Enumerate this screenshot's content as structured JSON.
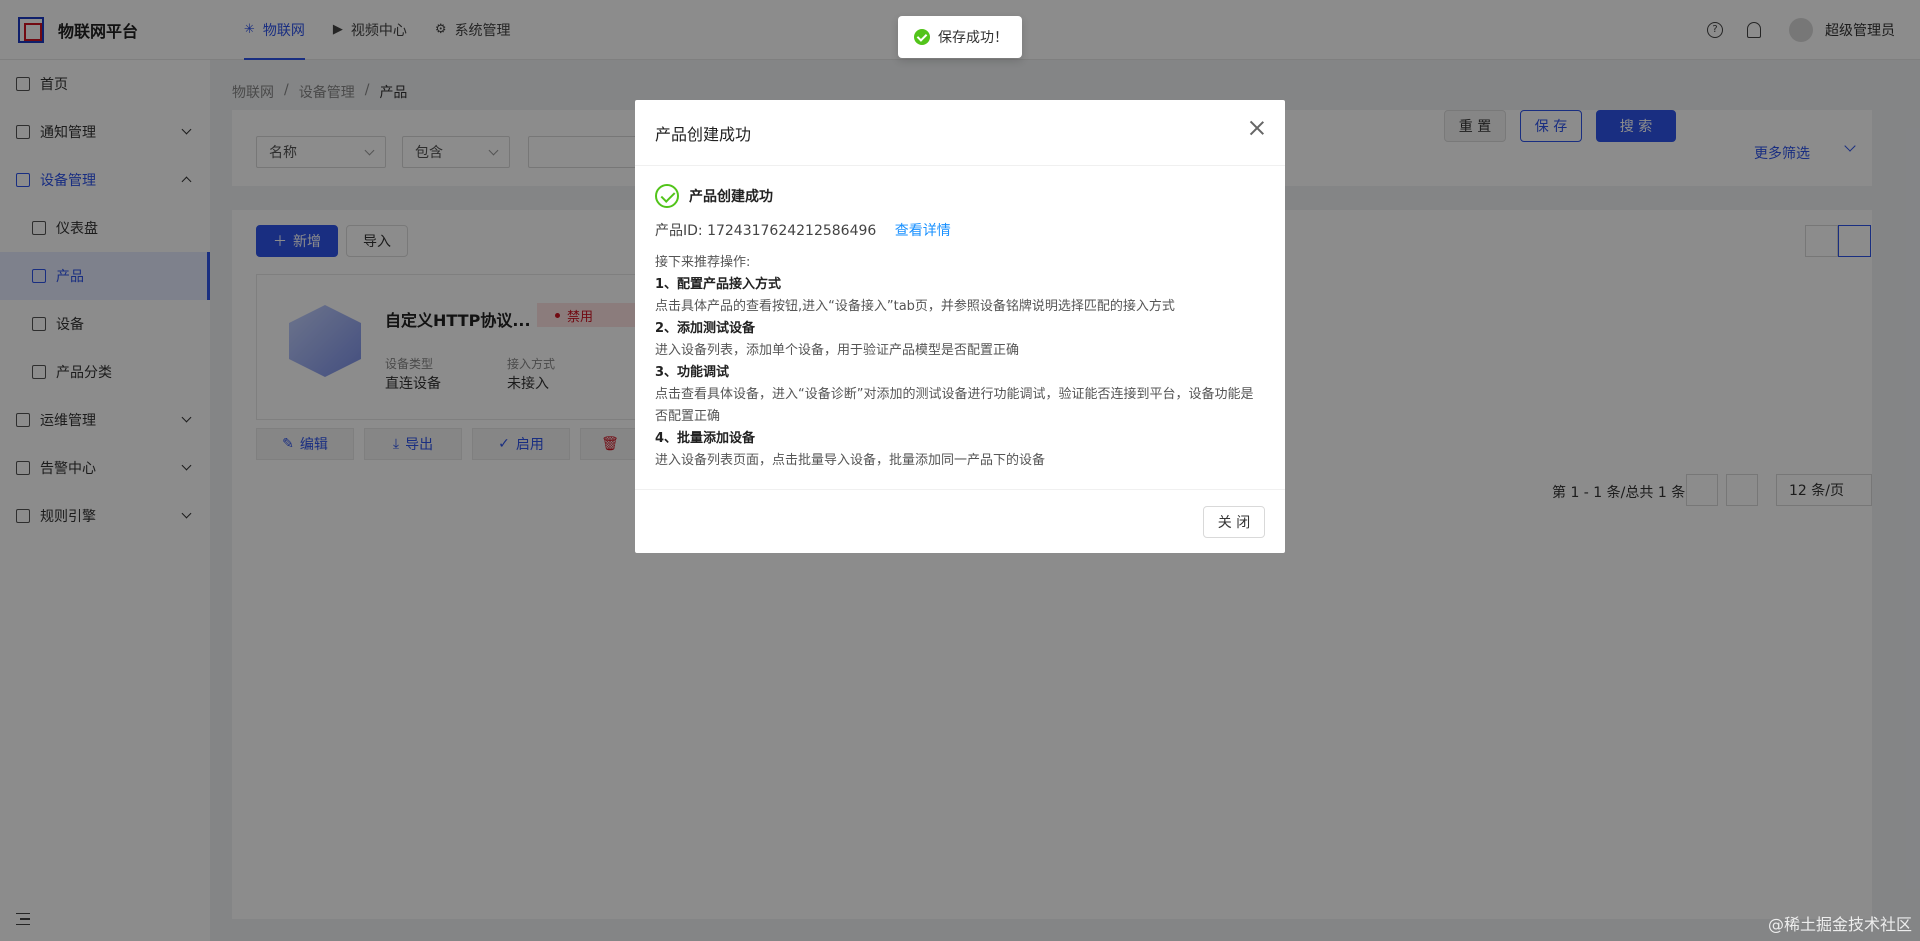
{
  "header": {
    "app_title": "物联网平台",
    "nav": [
      {
        "label": "物联网",
        "icon": "iot-icon"
      },
      {
        "label": "视频中心",
        "icon": "video-icon"
      },
      {
        "label": "系统管理",
        "icon": "settings-icon"
      }
    ],
    "username": "超级管理员"
  },
  "sidebar": {
    "items": [
      {
        "label": "首页"
      },
      {
        "label": "通知管理"
      },
      {
        "label": "设备管理"
      },
      {
        "label": "仪表盘"
      },
      {
        "label": "产品"
      },
      {
        "label": "设备"
      },
      {
        "label": "产品分类"
      },
      {
        "label": "运维管理"
      },
      {
        "label": "告警中心"
      },
      {
        "label": "规则引擎"
      }
    ]
  },
  "breadcrumb": [
    "物联网",
    "/",
    "设备管理",
    "/",
    "产品"
  ],
  "filter": {
    "field": "名称",
    "operator": "包含",
    "reset": "重 置",
    "save": "保 存",
    "search": "搜 索",
    "more": "更多筛选"
  },
  "list": {
    "add": "新增",
    "import": "导入",
    "card": {
      "name": "自定义HTTP协议...",
      "status": "禁用",
      "device_type_label": "设备类型",
      "device_type": "直连设备",
      "access_label": "接入方式",
      "access": "未接入"
    },
    "actions": {
      "edit": "编辑",
      "export": "导出",
      "enable": "启用"
    },
    "pagination": {
      "summary": "第 1 - 1 条/总共 1 条",
      "page_size": "12 条/页"
    }
  },
  "toast": {
    "text": "保存成功！"
  },
  "modal": {
    "title": "产品创建成功",
    "success_title": "产品创建成功",
    "id_text": "产品ID: 1724317624212586496",
    "detail_link": "查看详情",
    "intro": "接下来推荐操作:",
    "steps": [
      {
        "title": "1、配置产品接入方式",
        "desc": "点击具体产品的查看按钮,进入“设备接入”tab页，并参照设备铭牌说明选择匹配的接入方式"
      },
      {
        "title": "2、添加测试设备",
        "desc": "进入设备列表，添加单个设备，用于验证产品模型是否配置正确"
      },
      {
        "title": "3、功能调试",
        "desc": "点击查看具体设备，进入“设备诊断”对添加的测试设备进行功能调试，验证能否连接到平台，设备功能是否配置正确"
      },
      {
        "title": "4、批量添加设备",
        "desc": "进入设备列表页面，点击批量导入设备，批量添加同一产品下的设备"
      }
    ],
    "close": "关 闭"
  },
  "watermark": "@稀土掘金技术社区"
}
